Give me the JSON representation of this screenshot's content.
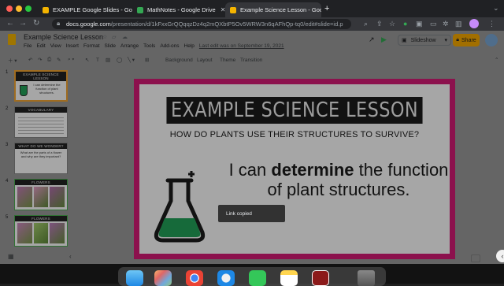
{
  "browser": {
    "tabs": [
      {
        "title": "EXAMPLE Google Slides - Goo",
        "favicon_color": "#f4b400",
        "active": false
      },
      {
        "title": "MathNotes - Google Drive",
        "favicon_color": "#34a853",
        "active": false
      },
      {
        "title": "Example Science Lesson - Goo",
        "favicon_color": "#f4b400",
        "active": true
      }
    ],
    "new_tab": "+",
    "url_host": "docs.google.com",
    "url_path": "/presentation/d/1kFxxGrQQqqzDz4q2mQXbtP5Ov5WRW3n6qAFhQp-tq0/edit#slide=id.p"
  },
  "app": {
    "title": "Example Science Lesson",
    "menu": [
      "File",
      "Edit",
      "View",
      "Insert",
      "Format",
      "Slide",
      "Arrange",
      "Tools",
      "Add-ons",
      "Help"
    ],
    "last_edit": "Last edit was on September 19, 2021",
    "slideshow_label": "Slideshow",
    "share_label": "Share",
    "toolbar": {
      "background": "Background",
      "layout": "Layout",
      "theme": "Theme",
      "transition": "Transition"
    },
    "accent_color": "#f9ab00"
  },
  "filmstrip": [
    {
      "num": "1",
      "title": "EXAMPLE SCIENCE LESSON",
      "body": "I can determine the function of plant structures."
    },
    {
      "num": "2",
      "title": "VOCABULARY",
      "body": ""
    },
    {
      "num": "3",
      "title": "WHAT DO WE WONDER?",
      "body": "What are the parts of a flower and why are they important?"
    },
    {
      "num": "4",
      "title": "FLOWERS",
      "body": ""
    },
    {
      "num": "5",
      "title": "FLOWERS",
      "body": ""
    }
  ],
  "slide": {
    "title": "EXAMPLE SCIENCE LESSON",
    "subtitle": "HOW DO PLANTS USE THEIR STRUCTURES TO SURVIVE?",
    "objective_pre": "I can ",
    "objective_bold": "determine",
    "objective_post": " the function of plant structures.",
    "border_color": "#d81b77",
    "flask_color": "#22a35a"
  },
  "toast": "Link copied"
}
